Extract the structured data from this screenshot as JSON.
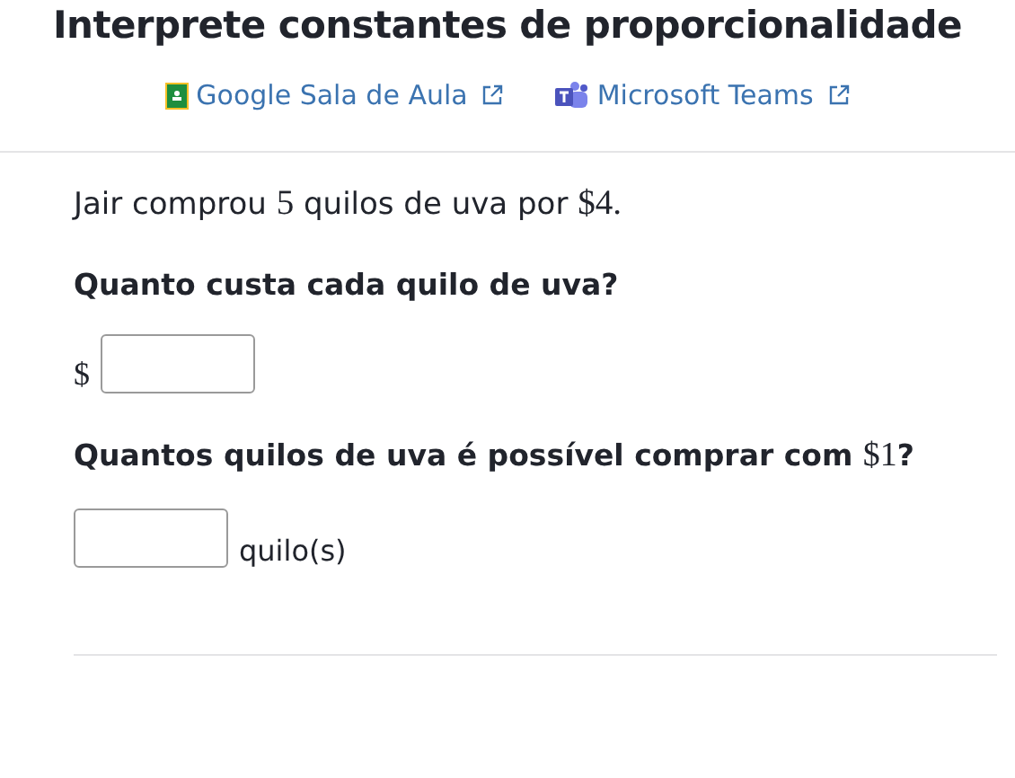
{
  "title": "Interprete constantes de proporcionalidade",
  "share_links": [
    {
      "label": "Google Sala de Aula",
      "kind": "classroom"
    },
    {
      "label": "Microsoft Teams",
      "kind": "teams"
    }
  ],
  "intro": [
    {
      "text": "Jair comprou ",
      "kind": "text"
    },
    {
      "text": "5",
      "kind": "math"
    },
    {
      "text": " quilos de uva por ",
      "kind": "text"
    },
    {
      "text": "$4.",
      "kind": "math"
    }
  ],
  "questions": [
    {
      "prompt": [
        {
          "text": "Quanto custa cada quilo de uva?",
          "kind": "text"
        }
      ],
      "prefix": "$"
    },
    {
      "prompt": [
        {
          "text": "Quantos quilos de uva é possível comprar com ",
          "kind": "text"
        },
        {
          "text": "$1",
          "kind": "math"
        },
        {
          "text": "?",
          "kind": "text"
        }
      ],
      "suffix": "quilo(s)"
    }
  ]
}
